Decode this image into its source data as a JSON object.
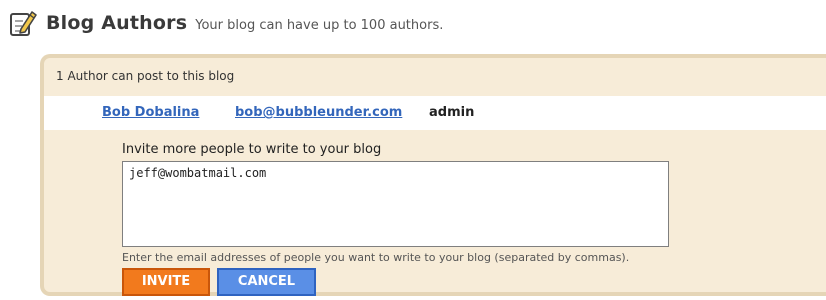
{
  "header": {
    "title": "Blog Authors",
    "subtitle": "Your blog can have up to 100 authors.",
    "icon": "edit-pencil-icon"
  },
  "panel": {
    "count_text": "1 Author can post to this blog",
    "authors": [
      {
        "name": "Bob Dobalina",
        "email": "bob@bubbleunder.com",
        "role": "admin"
      }
    ],
    "invite": {
      "label": "Invite more people to write to your blog",
      "value": "jeff@wombatmail.com",
      "hint": "Enter the email addresses of people you want to write to your blog (separated by commas)."
    },
    "buttons": {
      "invite_label": "INVITE",
      "cancel_label": "CANCEL"
    }
  },
  "colors": {
    "panel_bg": "#f7ecd8",
    "panel_border": "#e5d5b6",
    "link": "#3366bb",
    "invite_button": "#f27a1d",
    "cancel_button": "#5a8fe6"
  }
}
